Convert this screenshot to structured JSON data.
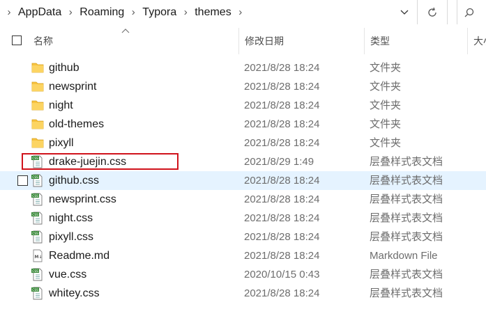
{
  "address_bar": {
    "breadcrumb": [
      "AppData",
      "Roaming",
      "Typora",
      "themes"
    ]
  },
  "columns": {
    "name": "名称",
    "modified": "修改日期",
    "type": "类型",
    "size": "大小"
  },
  "files": [
    {
      "name": "github",
      "date": "2021/8/28 18:24",
      "type": "文件夹",
      "icon": "folder-icon"
    },
    {
      "name": "newsprint",
      "date": "2021/8/28 18:24",
      "type": "文件夹",
      "icon": "folder-icon"
    },
    {
      "name": "night",
      "date": "2021/8/28 18:24",
      "type": "文件夹",
      "icon": "folder-icon"
    },
    {
      "name": "old-themes",
      "date": "2021/8/28 18:24",
      "type": "文件夹",
      "icon": "folder-icon"
    },
    {
      "name": "pixyll",
      "date": "2021/8/28 18:24",
      "type": "文件夹",
      "icon": "folder-icon"
    },
    {
      "name": "drake-juejin.css",
      "date": "2021/8/29 1:49",
      "type": "层叠样式表文档",
      "icon": "css-file-icon"
    },
    {
      "name": "github.css",
      "date": "2021/8/28 18:24",
      "type": "层叠样式表文档",
      "icon": "css-file-icon"
    },
    {
      "name": "newsprint.css",
      "date": "2021/8/28 18:24",
      "type": "层叠样式表文档",
      "icon": "css-file-icon"
    },
    {
      "name": "night.css",
      "date": "2021/8/28 18:24",
      "type": "层叠样式表文档",
      "icon": "css-file-icon"
    },
    {
      "name": "pixyll.css",
      "date": "2021/8/28 18:24",
      "type": "层叠样式表文档",
      "icon": "css-file-icon"
    },
    {
      "name": "Readme.md",
      "date": "2021/8/28 18:24",
      "type": "Markdown File",
      "icon": "markdown-file-icon"
    },
    {
      "name": "vue.css",
      "date": "2020/10/15 0:43",
      "type": "层叠样式表文档",
      "icon": "css-file-icon"
    },
    {
      "name": "whitey.css",
      "date": "2021/8/28 18:24",
      "type": "层叠样式表文档",
      "icon": "css-file-icon"
    }
  ],
  "hovered_row": "github.css",
  "highlighted_row": "drake-juejin.css",
  "colors": {
    "hover_bg": "#e5f3ff",
    "highlight_border": "#d0121b",
    "folder": "#f8c340"
  }
}
